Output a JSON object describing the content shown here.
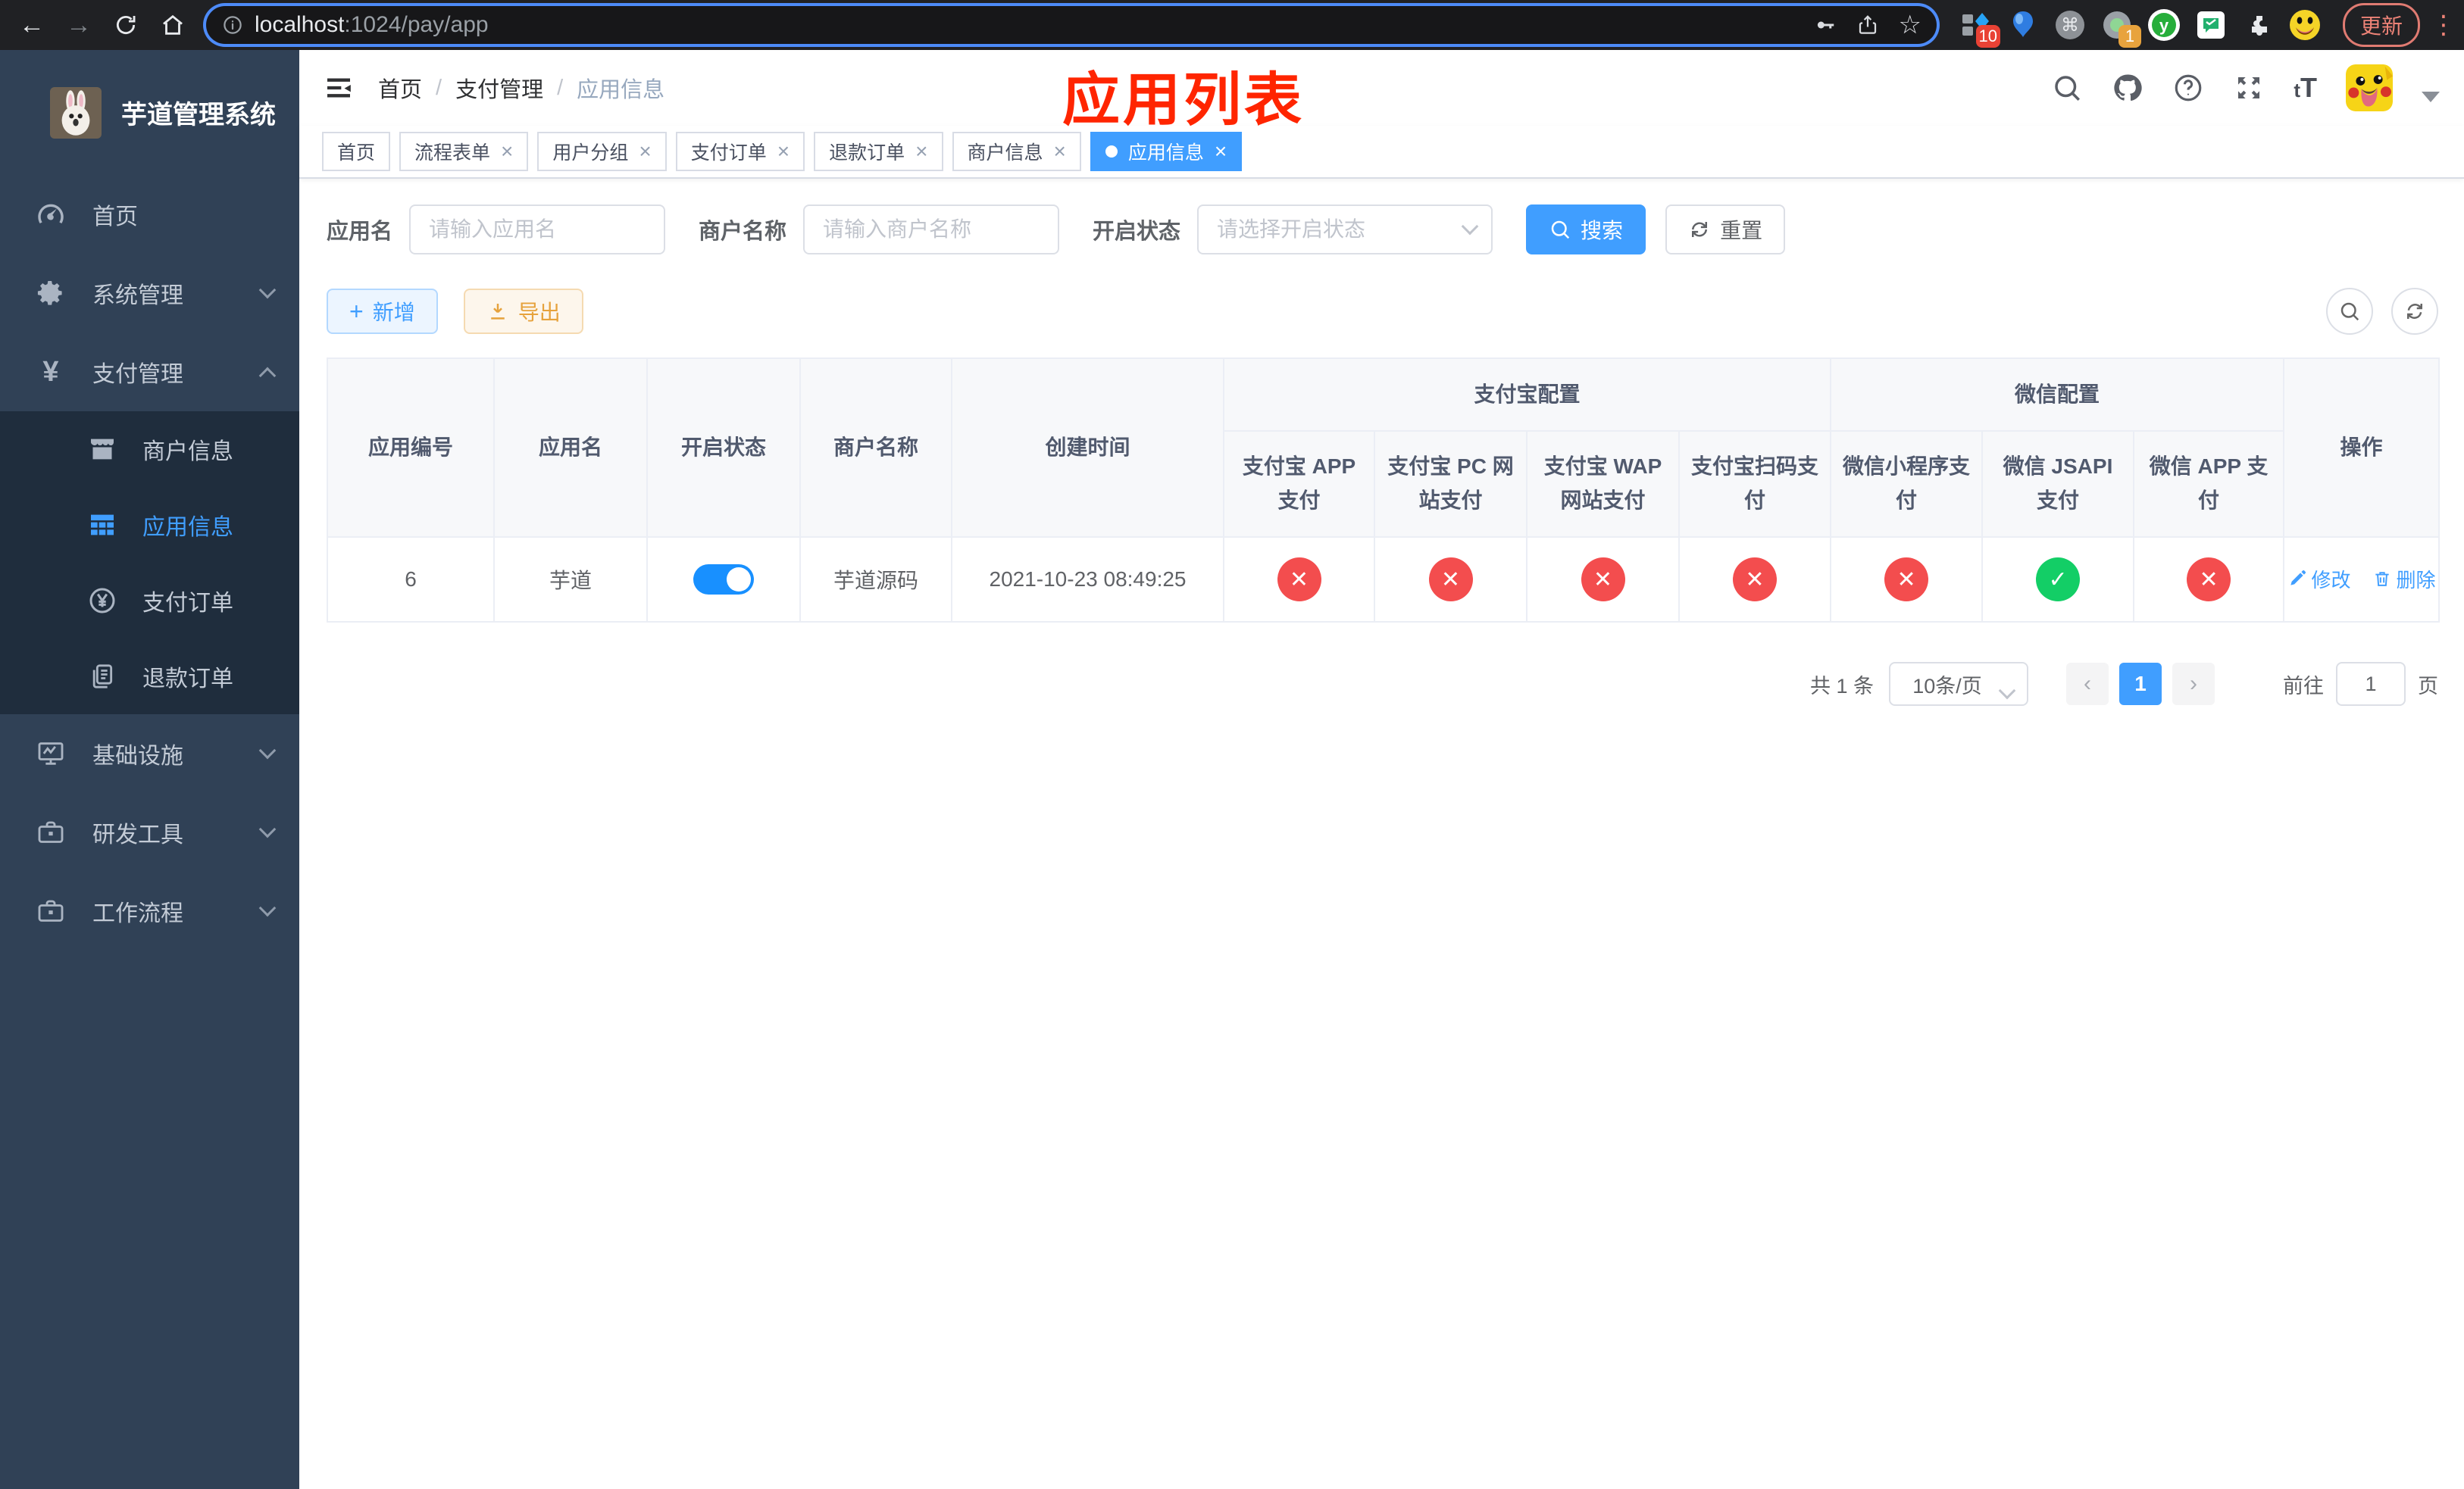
{
  "browser": {
    "url_host": "localhost",
    "url_path": ":1024/pay/app",
    "update_label": "更新",
    "extensions": [
      {
        "key": "blue-diamond",
        "badge": "10"
      },
      {
        "key": "balloon",
        "badge": ""
      },
      {
        "key": "command",
        "badge": ""
      },
      {
        "key": "green-dot",
        "badge": "1"
      },
      {
        "key": "y-circle",
        "badge": ""
      },
      {
        "key": "chat",
        "badge": ""
      },
      {
        "key": "puzzle",
        "badge": ""
      },
      {
        "key": "emoji",
        "badge": ""
      }
    ]
  },
  "sidebar": {
    "title": "芋道管理系统",
    "items": [
      {
        "key": "home",
        "label": "首页",
        "icon": "dashboard",
        "expandable": false
      },
      {
        "key": "system",
        "label": "系统管理",
        "icon": "gear",
        "expandable": true,
        "expanded": false
      },
      {
        "key": "payment",
        "label": "支付管理",
        "icon": "yen",
        "expandable": true,
        "expanded": true,
        "children": [
          {
            "key": "merchant-info",
            "label": "商户信息",
            "icon": "shop",
            "active": false
          },
          {
            "key": "app-info",
            "label": "应用信息",
            "icon": "grid",
            "active": true
          },
          {
            "key": "pay-order",
            "label": "支付订单",
            "icon": "yen-circle",
            "active": false
          },
          {
            "key": "refund-order",
            "label": "退款订单",
            "icon": "document",
            "active": false
          }
        ]
      },
      {
        "key": "infrastructure",
        "label": "基础设施",
        "icon": "monitor",
        "expandable": true,
        "expanded": false
      },
      {
        "key": "dev-tools",
        "label": "研发工具",
        "icon": "briefcase",
        "expandable": true,
        "expanded": false
      },
      {
        "key": "workflow",
        "label": "工作流程",
        "icon": "briefcase",
        "expandable": true,
        "expanded": false
      }
    ]
  },
  "navbar": {
    "breadcrumb": [
      "首页",
      "支付管理",
      "应用信息"
    ],
    "annotation": "应用列表"
  },
  "tabs": [
    {
      "key": "home",
      "label": "首页",
      "closable": false,
      "active": false
    },
    {
      "key": "flow-form",
      "label": "流程表单",
      "closable": true,
      "active": false
    },
    {
      "key": "user-group",
      "label": "用户分组",
      "closable": true,
      "active": false
    },
    {
      "key": "pay-order",
      "label": "支付订单",
      "closable": true,
      "active": false
    },
    {
      "key": "refund-order",
      "label": "退款订单",
      "closable": true,
      "active": false
    },
    {
      "key": "merchant-info",
      "label": "商户信息",
      "closable": true,
      "active": false
    },
    {
      "key": "app-info",
      "label": "应用信息",
      "closable": true,
      "active": true
    }
  ],
  "filters": {
    "app_name_label": "应用名",
    "app_name_placeholder": "请输入应用名",
    "merchant_label": "商户名称",
    "merchant_placeholder": "请输入商户名称",
    "status_label": "开启状态",
    "status_placeholder": "请选择开启状态",
    "search_label": "搜索",
    "reset_label": "重置"
  },
  "toolbar": {
    "add_label": "新增",
    "export_label": "导出"
  },
  "table": {
    "columns_left": [
      "应用编号",
      "应用名",
      "开启状态",
      "商户名称",
      "创建时间"
    ],
    "groups": [
      {
        "label": "支付宝配置",
        "children": [
          "支付宝 APP 支付",
          "支付宝 PC 网站支付",
          "支付宝 WAP 网站支付",
          "支付宝扫码支付"
        ]
      },
      {
        "label": "微信配置",
        "children": [
          "微信小程序支付",
          "微信 JSAPI 支付",
          "微信 APP 支付"
        ]
      }
    ],
    "action_column": "操作",
    "rows": [
      {
        "id": "6",
        "name": "芋道",
        "enabled": true,
        "merchant": "芋道源码",
        "created_at": "2021-10-23 08:49:25",
        "channel_status": [
          false,
          false,
          false,
          false,
          false,
          true,
          false
        ],
        "edit_label": "修改",
        "delete_label": "删除"
      }
    ]
  },
  "pagination": {
    "total_label": "共 1 条",
    "page_size": "10条/页",
    "current_page": "1",
    "goto_label": "前往",
    "goto_value": "1",
    "goto_suffix": "页"
  },
  "colors": {
    "primary": "#409eff",
    "success": "#13ce66",
    "danger": "#f34d4e",
    "warning": "#e6a23c",
    "sidebar_bg": "#304156",
    "submenu_bg": "#1f2d3d",
    "annotation_red": "#ff2500",
    "switch_on": "#1890ff"
  }
}
